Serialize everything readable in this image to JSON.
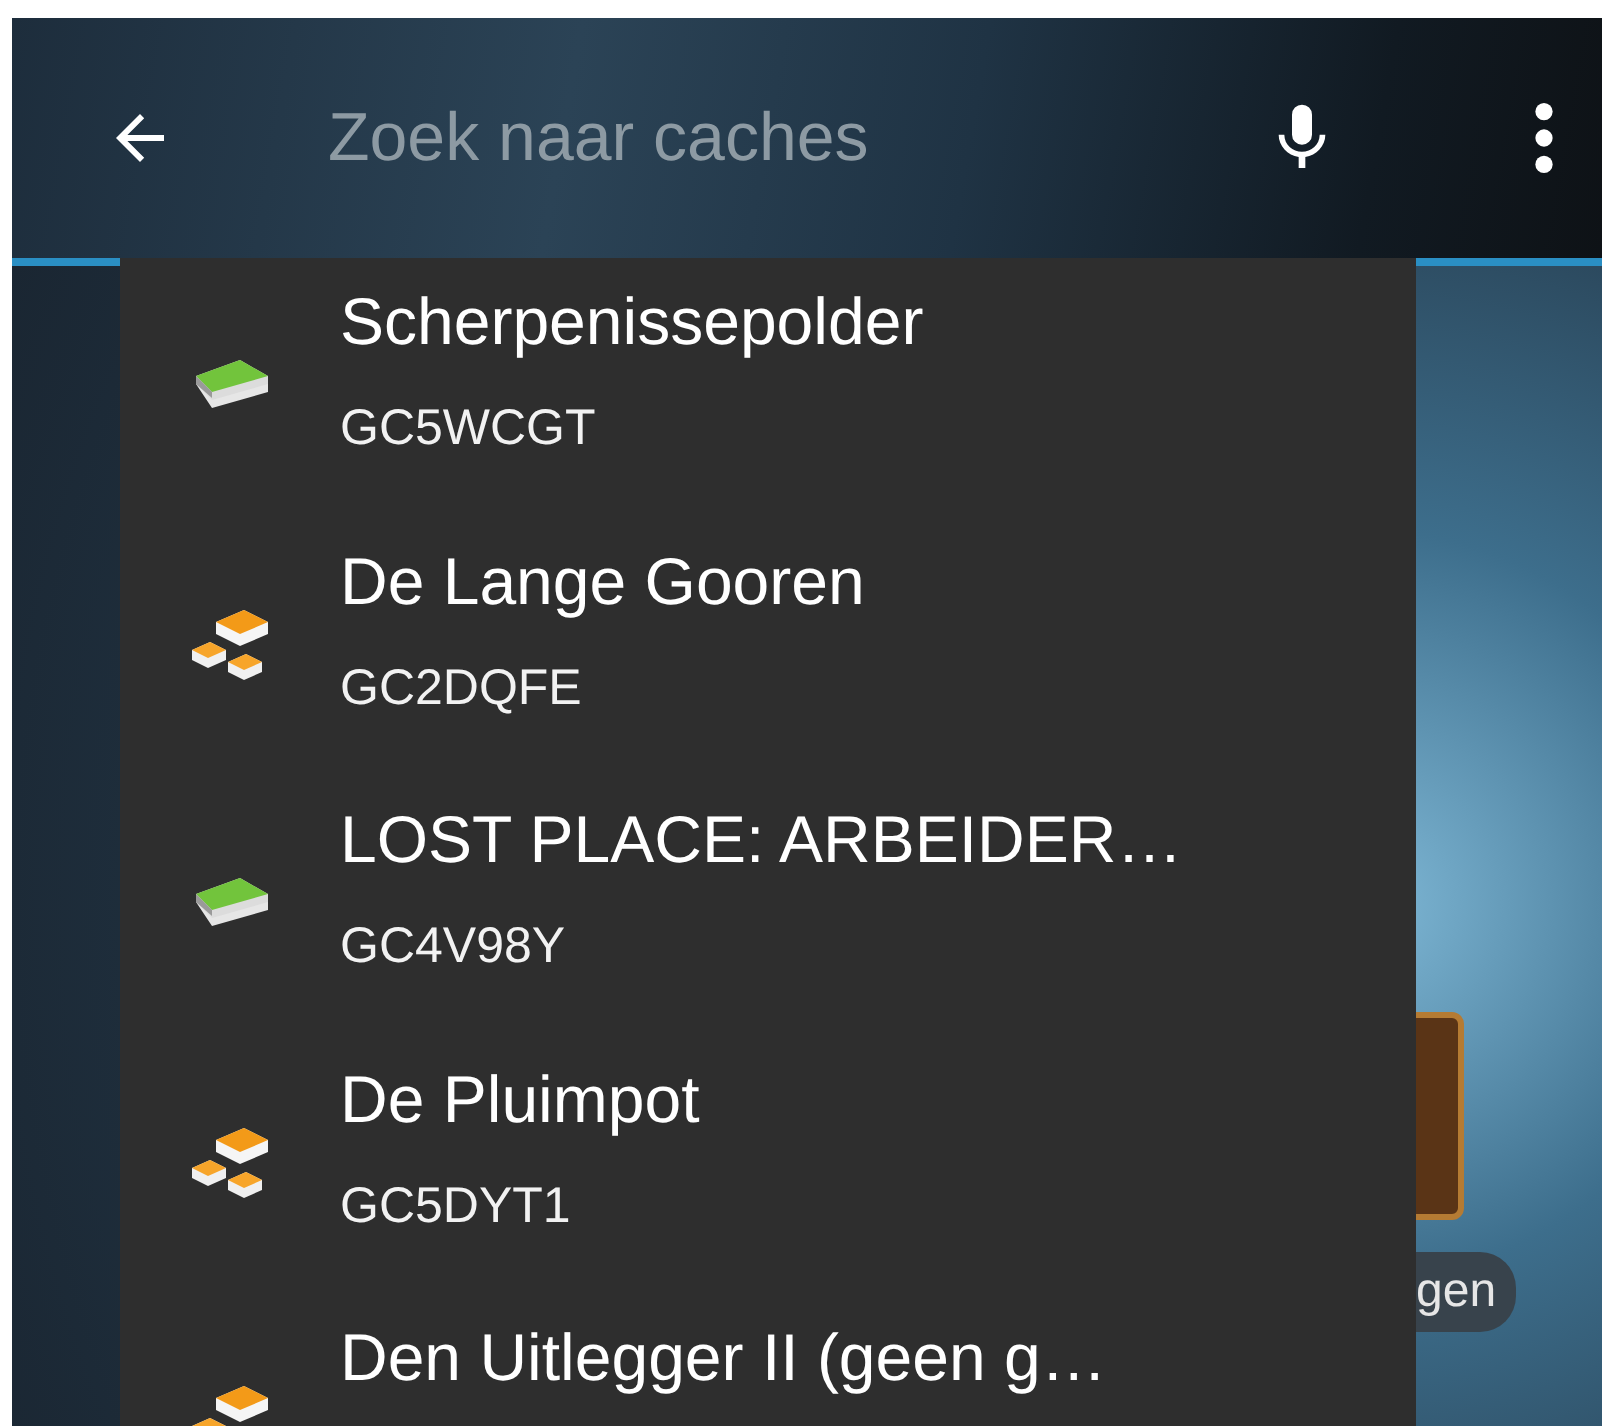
{
  "search_bar": {
    "placeholder": "Zoek naar caches"
  },
  "suggestions": [
    {
      "kind": "traditional",
      "name": "Scherpenissepolder",
      "code": "GC5WCGT"
    },
    {
      "kind": "multi",
      "name": "De Lange Gooren",
      "code": "GC2DQFE"
    },
    {
      "kind": "traditional",
      "name": "LOST PLACE: ARBEIDER…",
      "code": "GC4V98Y"
    },
    {
      "kind": "multi",
      "name": "De Pluimpot",
      "code": "GC5DYT1"
    },
    {
      "kind": "multi",
      "name": "Den Uitlegger II (geen g…"
    }
  ],
  "background": {
    "chip_label": "gen"
  }
}
